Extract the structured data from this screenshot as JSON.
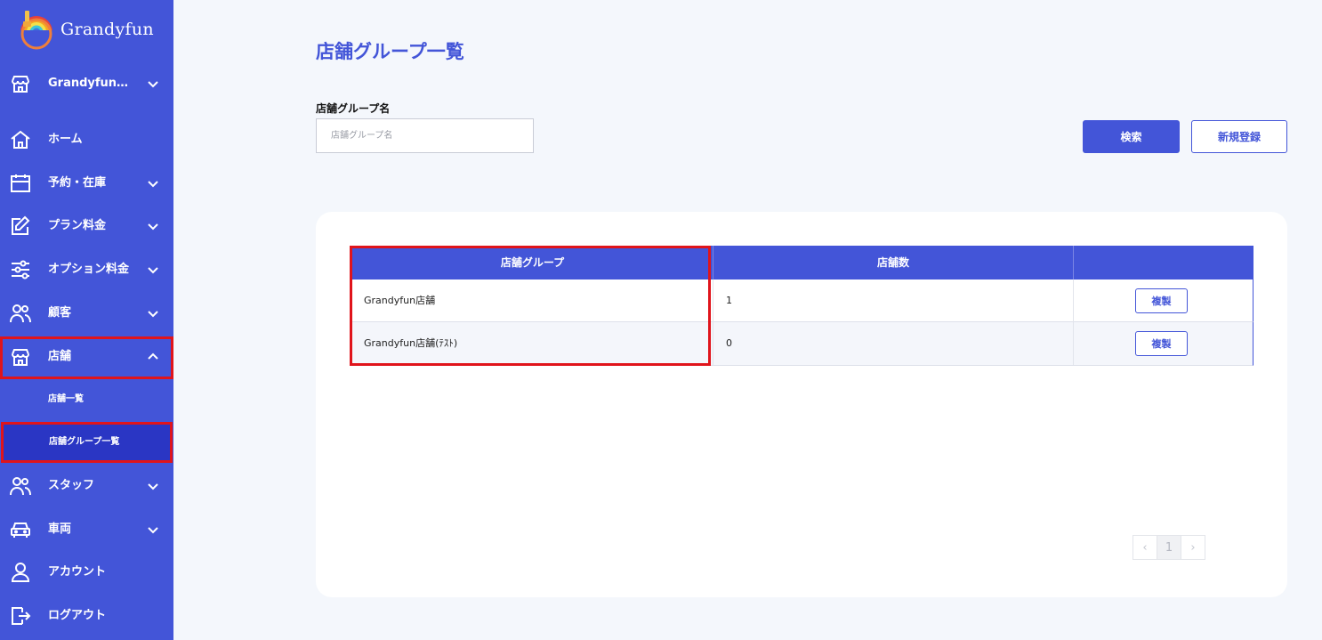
{
  "brand": {
    "name": "Grandyfun"
  },
  "sidebar": {
    "store_selector": "Grandyfun…",
    "items": [
      {
        "label": "ホーム",
        "icon": "home-icon"
      },
      {
        "label": "予約・在庫",
        "icon": "calendar-icon"
      },
      {
        "label": "プラン料金",
        "icon": "edit-icon"
      },
      {
        "label": "オプション料金",
        "icon": "sliders-icon"
      },
      {
        "label": "顧客",
        "icon": "users-icon"
      },
      {
        "label": "店舗",
        "icon": "store-icon"
      },
      {
        "label": "スタッフ",
        "icon": "users-icon"
      },
      {
        "label": "車両",
        "icon": "car-icon"
      },
      {
        "label": "アカウント",
        "icon": "user-icon"
      },
      {
        "label": "ログアウト",
        "icon": "logout-icon"
      }
    ],
    "sub_items": [
      {
        "label": "店舗一覧"
      },
      {
        "label": "店舗グループ一覧"
      }
    ]
  },
  "main": {
    "title": "店舗グループ一覧",
    "search": {
      "label": "店舗グループ名",
      "placeholder": "店舗グループ名",
      "value": ""
    },
    "buttons": {
      "search": "検索",
      "new": "新規登録"
    },
    "table": {
      "headers": [
        "店舗グループ",
        "店舗数",
        ""
      ],
      "rows": [
        {
          "group": "Grandyfun店舗",
          "count": "1",
          "action": "複製"
        },
        {
          "group": "Grandyfun店舗(ﾃｽﾄ)",
          "count": "0",
          "action": "複製"
        }
      ]
    },
    "pagination": {
      "prev": "‹",
      "current": "1",
      "next": "›"
    }
  },
  "colors": {
    "primary": "#4355d8",
    "active_sub": "#2a36c4",
    "highlight": "#e0141b",
    "background": "#f4f7fc"
  }
}
